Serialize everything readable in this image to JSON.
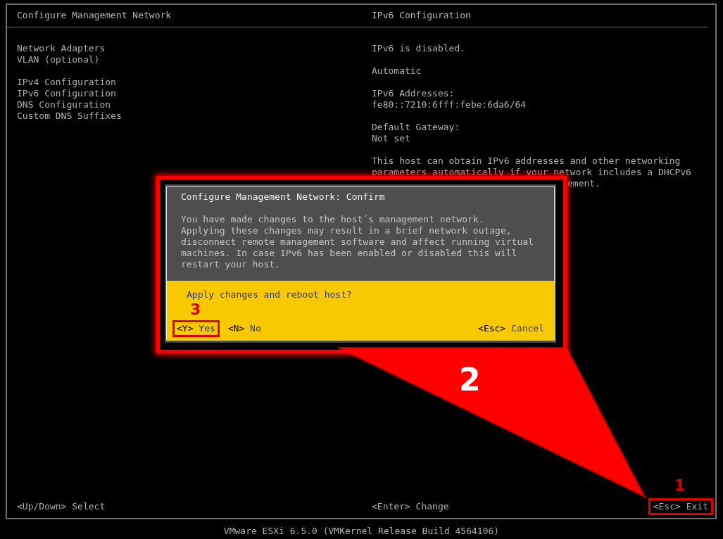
{
  "left_panel": {
    "title": "Configure Management Network",
    "menu_groups": [
      {
        "items": [
          "Network Adapters",
          "VLAN (optional)"
        ]
      },
      {
        "items": [
          "IPv4 Configuration",
          "IPv6 Configuration",
          "DNS Configuration",
          "Custom DNS Suffixes"
        ]
      }
    ]
  },
  "right_panel": {
    "title": "IPv6 Configuration",
    "blocks": [
      {
        "lines": [
          "IPv6 is disabled."
        ]
      },
      {
        "lines": [
          "Automatic"
        ]
      },
      {
        "lines": [
          "IPv6 Addresses:",
          "fe80::7210:6fff:febe:6da6/64"
        ]
      },
      {
        "lines": [
          "Default Gateway:",
          "Not set"
        ]
      },
      {
        "lines": [
          "This host can obtain IPv6 addresses and other networking",
          "parameters automatically if your network includes a DHCPv6"
        ]
      }
    ],
    "cut_fragment": "ement."
  },
  "dialog": {
    "title": "Configure Management Network: Confirm",
    "message": "You have made changes to the host´s management network.\nApplying these changes may result in a brief network outage,\ndisconnect remote management software and affect running virtual\nmachines. In case IPv6 has been enabled or disabled this will\nrestart your host.",
    "question": "Apply changes and reboot host?",
    "left_buttons": [
      {
        "key": "<Y>",
        "label": "Yes",
        "highlighted": true
      },
      {
        "key": "<N>",
        "label": "No",
        "highlighted": false
      }
    ],
    "right_buttons": [
      {
        "key": "<Esc>",
        "label": "Cancel",
        "highlighted": false
      }
    ]
  },
  "footer": {
    "hints": [
      {
        "text": "<Up/Down> Select",
        "highlighted": false
      },
      {
        "text": "<Enter> Change",
        "highlighted": false
      },
      {
        "text": "<Esc> Exit",
        "highlighted": true
      }
    ]
  },
  "version": "VMware ESXi 6.5.0 (VMKernel Release Build 4564106)",
  "annotation_numbers": [
    "1",
    "2",
    "3"
  ]
}
